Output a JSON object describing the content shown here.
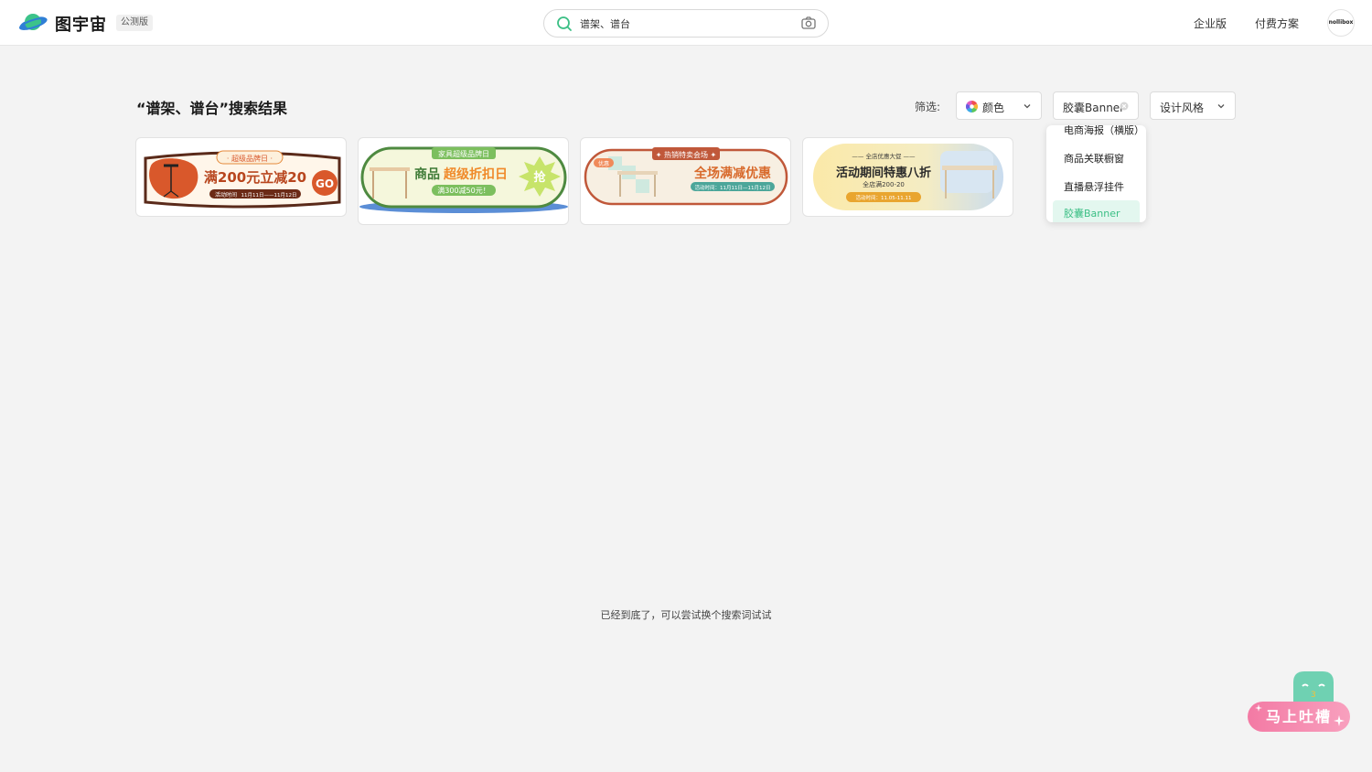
{
  "header": {
    "brand": "图宇宙",
    "beta_badge": "公测版",
    "search_value": "谱架、谱台",
    "nav": {
      "enterprise": "企业版",
      "pricing": "付费方案"
    },
    "avatar_text": "nollibox"
  },
  "results": {
    "title": "“谱架、谱台”搜索结果",
    "filter_label": "筛选:",
    "filters": {
      "color": "颜色",
      "type": "胶囊Banner",
      "style": "设计风格"
    }
  },
  "dropdown": {
    "items": [
      "电商海报（横版）",
      "商品关联橱窗",
      "直播悬浮挂件",
      "胶囊Banner"
    ]
  },
  "cards": [
    {
      "tag": "· 超级品牌日 ·",
      "headline": "满200元立减20",
      "cta": "GO",
      "time_label": "活动时间",
      "time": "11月11日——11月12日"
    },
    {
      "tag": "家具超级品牌日",
      "headline_a": "商品",
      "headline_b": "超级折扣日",
      "sub": "满300减50元！",
      "burst": "抢"
    },
    {
      "tag": "✦ 热销特卖会场 ✦",
      "corner": "优惠",
      "headline": "全场满减优惠",
      "time": "活动时间：11月11日—11月12日"
    },
    {
      "tag": "—— 全店优惠大促 ——",
      "headline": "活动期间特惠八折",
      "sub": "全店满200-20",
      "time": "活动时间：11.05-11.11"
    }
  ],
  "footer_note": "已经到底了，可以尝试换个搜索词试试",
  "feedback": {
    "label": "马上吐槽"
  }
}
